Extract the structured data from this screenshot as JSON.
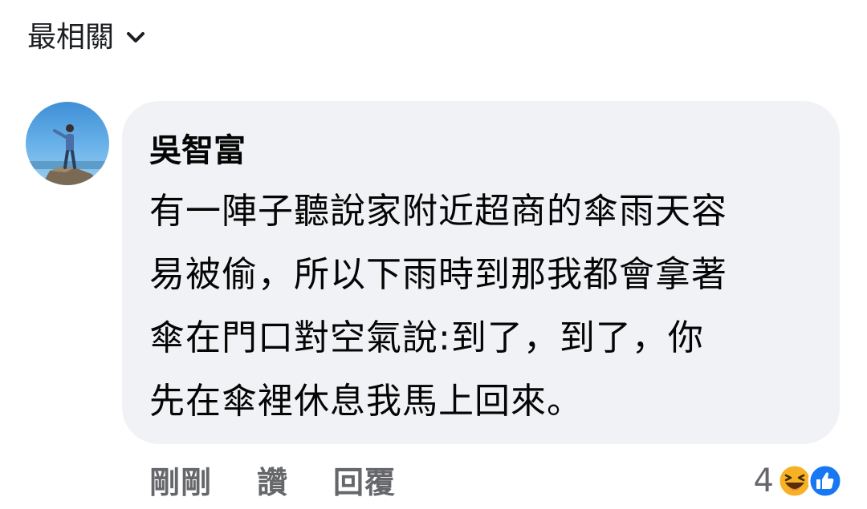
{
  "sort": {
    "label": "最相關"
  },
  "comment": {
    "author": "吳智富",
    "lines": [
      "有一陣子聽說家附近超商的傘雨天容",
      "易被偷，所以下雨時到那我都會拿著",
      "傘在門口對空氣說:到了，到了，你",
      "先在傘裡休息我馬上回來。"
    ]
  },
  "actions": {
    "time": "剛剛",
    "like": "讚",
    "reply": "回覆"
  },
  "reactions": {
    "count": "4",
    "icons": [
      "haha-icon",
      "like-icon"
    ]
  },
  "colors": {
    "bubble": "#f0f2f5",
    "secondary_text": "#65676b",
    "like_blue": "#1877f2",
    "haha_yellow": "#f7b125"
  }
}
